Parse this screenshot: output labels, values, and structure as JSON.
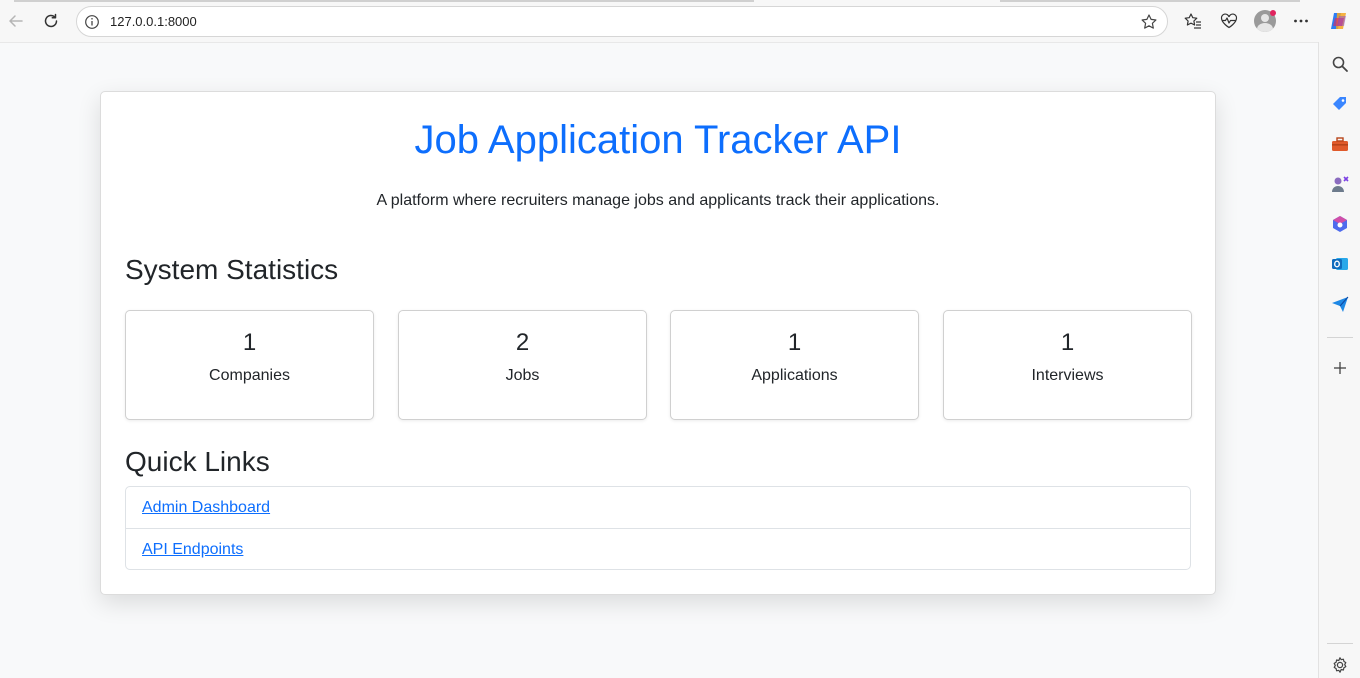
{
  "browser": {
    "url": "127.0.0.1:8000",
    "icons": [
      "back-icon",
      "reload-icon",
      "site-info-icon",
      "favorite-star-icon",
      "favorites-icon",
      "health-icon",
      "profile-icon",
      "more-icon",
      "copilot-icon"
    ]
  },
  "sidebar": {
    "icons": [
      "search-icon",
      "shopping-tag-icon",
      "toolbox-icon",
      "games-icon",
      "microsoft365-icon",
      "outlook-icon",
      "send-icon",
      "add-icon",
      "settings-icon"
    ]
  },
  "page": {
    "title": "Job Application Tracker API",
    "subtitle": "A platform where recruiters manage jobs and applicants track their applications.",
    "stats_heading": "System Statistics",
    "stats": [
      {
        "value": "1",
        "label": "Companies"
      },
      {
        "value": "2",
        "label": "Jobs"
      },
      {
        "value": "1",
        "label": "Applications"
      },
      {
        "value": "1",
        "label": "Interviews"
      }
    ],
    "links_heading": "Quick Links",
    "links": [
      {
        "label": "Admin Dashboard"
      },
      {
        "label": "API Endpoints"
      }
    ]
  },
  "colors": {
    "accent": "#0d6efd",
    "text": "#212529",
    "page_bg": "#f8f9fa"
  }
}
